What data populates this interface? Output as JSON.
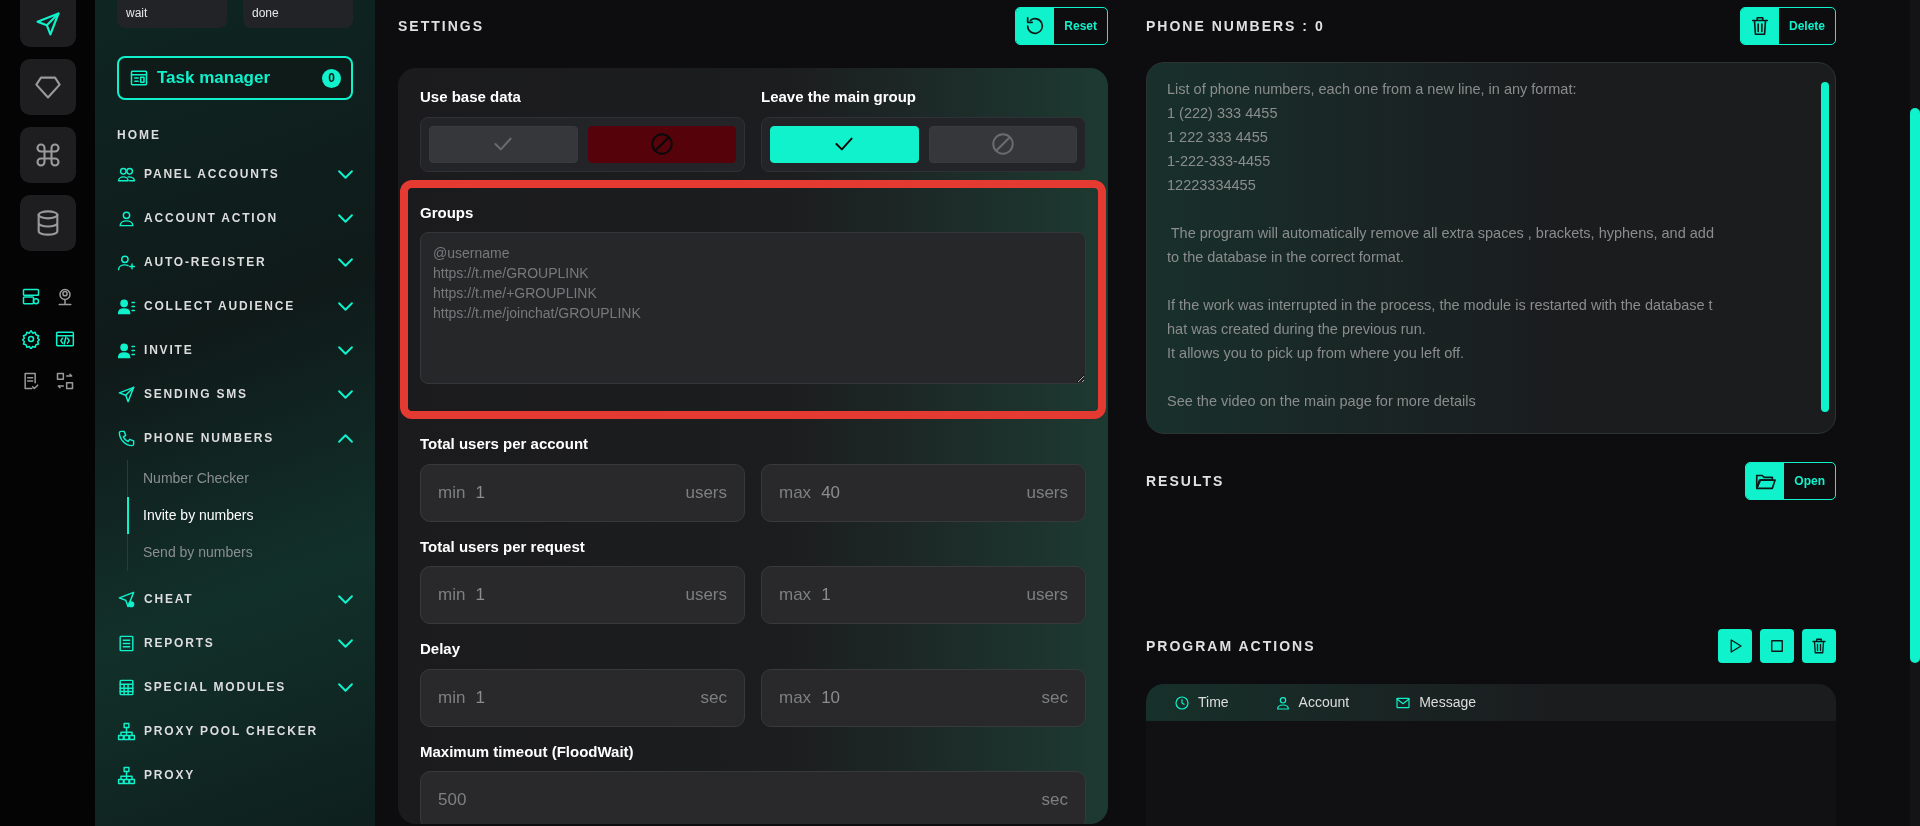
{
  "rail": {
    "tiles": [
      {
        "selected": true
      },
      {
        "selected": false
      },
      {
        "selected": false
      },
      {
        "selected": false
      }
    ],
    "shortcuts": [
      {
        "selected": true
      },
      {
        "selected": false
      },
      {
        "selected": true
      },
      {
        "selected": true
      },
      {
        "selected": false
      },
      {
        "selected": false
      }
    ]
  },
  "sidebar": {
    "status_boxes": [
      "wait",
      "done"
    ],
    "task_manager": {
      "label": "Task manager",
      "count": "0"
    },
    "home": "HOME",
    "items": [
      {
        "label": "PANEL ACCOUNTS",
        "kind": "group",
        "expanded": false
      },
      {
        "label": "ACCOUNT ACTION",
        "kind": "group",
        "expanded": false
      },
      {
        "label": "AUTO-REGISTER",
        "kind": "group",
        "expanded": false
      },
      {
        "label": "COLLECT AUDIENCE",
        "kind": "group",
        "expanded": false
      },
      {
        "label": "INVITE",
        "kind": "group",
        "expanded": false
      },
      {
        "label": "SENDING SMS",
        "kind": "group",
        "expanded": false
      },
      {
        "label": "PHONE NUMBERS",
        "kind": "group",
        "expanded": true,
        "children": [
          {
            "label": "Number Checker",
            "selected": false
          },
          {
            "label": "Invite by numbers",
            "selected": true
          },
          {
            "label": "Send by numbers",
            "selected": false
          }
        ]
      },
      {
        "label": "CHEAT",
        "kind": "group",
        "expanded": false
      },
      {
        "label": "REPORTS",
        "kind": "group",
        "expanded": false
      },
      {
        "label": "SPECIAL MODULES",
        "kind": "group",
        "expanded": false
      },
      {
        "label": "PROXY POOL CHECKER",
        "kind": "link"
      },
      {
        "label": "PROXY",
        "kind": "link"
      }
    ]
  },
  "settings": {
    "title": "SETTINGS",
    "reset_button": "Reset",
    "toggles": [
      {
        "label": "Use base data",
        "options": [
          {
            "kind": "yes",
            "selected": false
          },
          {
            "kind": "no",
            "selected": true
          }
        ]
      },
      {
        "label": "Leave the main group",
        "options": [
          {
            "kind": "yes",
            "selected": true
          },
          {
            "kind": "no",
            "selected": false
          }
        ]
      }
    ],
    "groups": {
      "label": "Groups",
      "highlighted": true,
      "placeholder": [
        "@username",
        "https://t.me/GROUPLINK",
        "https://t.me/+GROUPLINK",
        "https://t.me/joinchat/GROUPLINK"
      ]
    },
    "ranges": [
      {
        "label": "Total users per account",
        "fields": [
          {
            "prefix": "min",
            "value": "1",
            "unit": "users"
          },
          {
            "prefix": "max",
            "value": "40",
            "unit": "users"
          }
        ]
      },
      {
        "label": "Total users per request",
        "fields": [
          {
            "prefix": "min",
            "value": "1",
            "unit": "users"
          },
          {
            "prefix": "max",
            "value": "1",
            "unit": "users"
          }
        ]
      },
      {
        "label": "Delay",
        "fields": [
          {
            "prefix": "min",
            "value": "1",
            "unit": "sec"
          },
          {
            "prefix": "max",
            "value": "10",
            "unit": "sec"
          }
        ]
      },
      {
        "label": "Maximum timeout (FloodWait)",
        "fields": [
          {
            "value": "500",
            "unit": "sec"
          }
        ]
      }
    ]
  },
  "phone_numbers": {
    "title": "PHONE NUMBERS : 0",
    "delete_button": "Delete",
    "placeholder": [
      [
        "List of phone numbers, each one from a new line, in any format:",
        "1 (222) 333 4455",
        "1 222 333 4455",
        "1-222-333-4455",
        "12223334455"
      ],
      [
        " The program will automatically remove all extra spaces , brackets, hyphens, and add",
        "to the database in the correct format."
      ],
      [
        "If the work was interrupted in the process, the module is restarted with the database t",
        "hat was created during the previous run.",
        "It allows you to pick up from where you left off."
      ],
      [
        "See the video on the main page for more details"
      ]
    ]
  },
  "results": {
    "title": "RESULTS",
    "open_button": "Open"
  },
  "program_actions": {
    "title": "PROGRAM ACTIONS",
    "columns": [
      "Time",
      "Account",
      "Message"
    ]
  }
}
